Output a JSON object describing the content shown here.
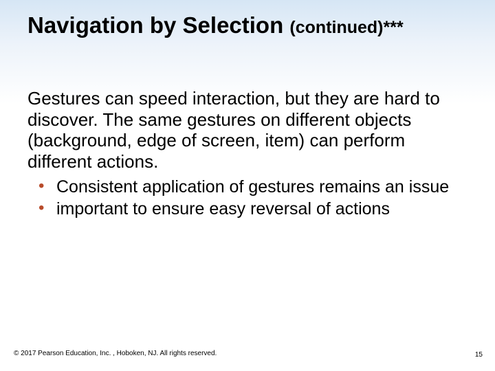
{
  "title": {
    "main": "Navigation by Selection ",
    "sub": "(continued)***"
  },
  "body": {
    "paragraph": "Gestures can speed interaction, but they are hard to discover. The same gestures on different objects (background, edge of screen, item) can perform different actions.",
    "bullets": [
      "Consistent application of gestures remains an issue",
      "important to ensure easy reversal of actions"
    ]
  },
  "footer": "© 2017 Pearson Education, Inc. , Hoboken, NJ.  All rights reserved.",
  "page_number": "15"
}
